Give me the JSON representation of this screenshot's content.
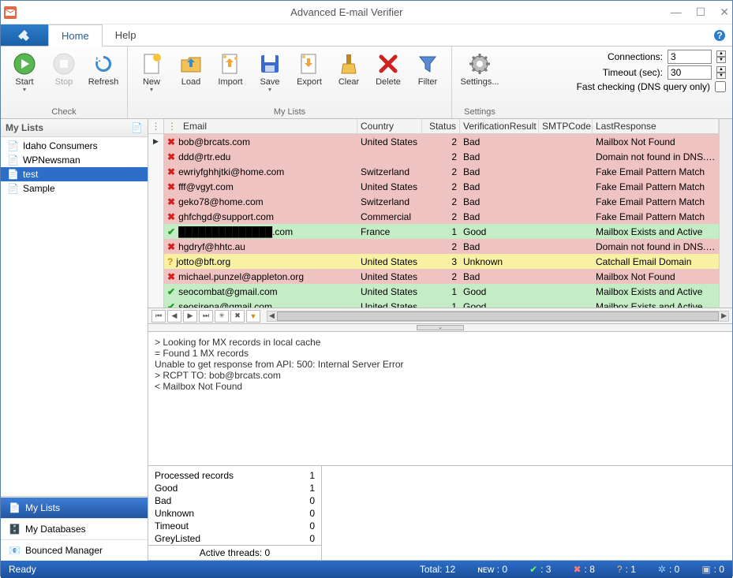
{
  "window": {
    "title": "Advanced E-mail Verifier"
  },
  "menu": {
    "home": "Home",
    "help": "Help"
  },
  "ribbon": {
    "start": "Start",
    "stop": "Stop",
    "refresh": "Refresh",
    "new": "New",
    "load": "Load",
    "import": "Import",
    "save": "Save",
    "export": "Export",
    "clear": "Clear",
    "delete": "Delete",
    "filter": "Filter",
    "settings": "Settings...",
    "group_check": "Check",
    "group_mylists": "My Lists",
    "group_settings": "Settings",
    "connections_lbl": "Connections:",
    "connections_val": "3",
    "timeout_lbl": "Timeout (sec):",
    "timeout_val": "30",
    "fast_lbl": "Fast checking (DNS query only)"
  },
  "sidebar": {
    "title": "My Lists",
    "items": [
      "Idaho Consumers",
      "WPNewsman",
      "test",
      "Sample"
    ],
    "nav": [
      "My Lists",
      "My Databases",
      "Bounced Manager"
    ]
  },
  "grid": {
    "headers": {
      "email": "Email",
      "country": "Country",
      "status": "Status",
      "result": "VerificationResult",
      "smtp": "SMTPCode",
      "resp": "LastResponse"
    },
    "rows": [
      {
        "s": "bad",
        "e": "bob@brcats.com",
        "c": "United States",
        "st": "2",
        "r": "Bad",
        "m": "",
        "p": "Mailbox Not Found"
      },
      {
        "s": "bad",
        "e": "ddd@rtr.edu",
        "c": "",
        "st": "2",
        "r": "Bad",
        "m": "",
        "p": "Domain not found in DNS. DNS Server Repo"
      },
      {
        "s": "bad",
        "e": "ewriyfghhjtki@home.com",
        "c": "Switzerland",
        "st": "2",
        "r": "Bad",
        "m": "",
        "p": "Fake Email Pattern Match"
      },
      {
        "s": "bad",
        "e": "fff@vgyt.com",
        "c": "United States",
        "st": "2",
        "r": "Bad",
        "m": "",
        "p": "Fake Email Pattern Match"
      },
      {
        "s": "bad",
        "e": "geko78@home.com",
        "c": "Switzerland",
        "st": "2",
        "r": "Bad",
        "m": "",
        "p": "Fake Email Pattern Match"
      },
      {
        "s": "bad",
        "e": "ghfchgd@support.com",
        "c": "Commercial",
        "st": "2",
        "r": "Bad",
        "m": "",
        "p": "Fake Email Pattern Match"
      },
      {
        "s": "good",
        "e": "██████████████.com",
        "c": "France",
        "st": "1",
        "r": "Good",
        "m": "",
        "p": "Mailbox Exists and Active"
      },
      {
        "s": "bad",
        "e": "hgdryf@hhtc.au",
        "c": "",
        "st": "2",
        "r": "Bad",
        "m": "",
        "p": "Domain not found in DNS. DNS Server Repo"
      },
      {
        "s": "unk",
        "e": "jotto@bft.org",
        "c": "United States",
        "st": "3",
        "r": "Unknown",
        "m": "",
        "p": "Catchall Email Domain"
      },
      {
        "s": "bad",
        "e": "michael.punzel@appleton.org",
        "c": "United States",
        "st": "2",
        "r": "Bad",
        "m": "",
        "p": "Mailbox Not Found"
      },
      {
        "s": "good",
        "e": "seocombat@gmail.com",
        "c": "United States",
        "st": "1",
        "r": "Good",
        "m": "",
        "p": "Mailbox Exists and Active"
      },
      {
        "s": "good",
        "e": "seosirena@gmail.com",
        "c": "United States",
        "st": "1",
        "r": "Good",
        "m": "",
        "p": "Mailbox Exists and Active"
      }
    ]
  },
  "log": "> Looking for MX records in local cache\n= Found 1 MX records\nUnable to get response from API: 500: Internal Server Error\n> RCPT TO: bob@brcats.com\n< Mailbox Not Found",
  "stats": {
    "rows": [
      {
        "k": "Processed records",
        "v": "1"
      },
      {
        "k": "Good",
        "v": "1"
      },
      {
        "k": "Bad",
        "v": "0"
      },
      {
        "k": "Unknown",
        "v": "0"
      },
      {
        "k": "Timeout",
        "v": "0"
      },
      {
        "k": "GreyListed",
        "v": "0"
      }
    ],
    "threads": "Active threads: 0"
  },
  "status": {
    "ready": "Ready",
    "total": "Total: 12",
    "new": "ɴᴇᴡ : 0",
    "good": ": 3",
    "bad": ": 8",
    "unknown": ": 1",
    "timeout": ": 0",
    "grey": ": 0"
  }
}
